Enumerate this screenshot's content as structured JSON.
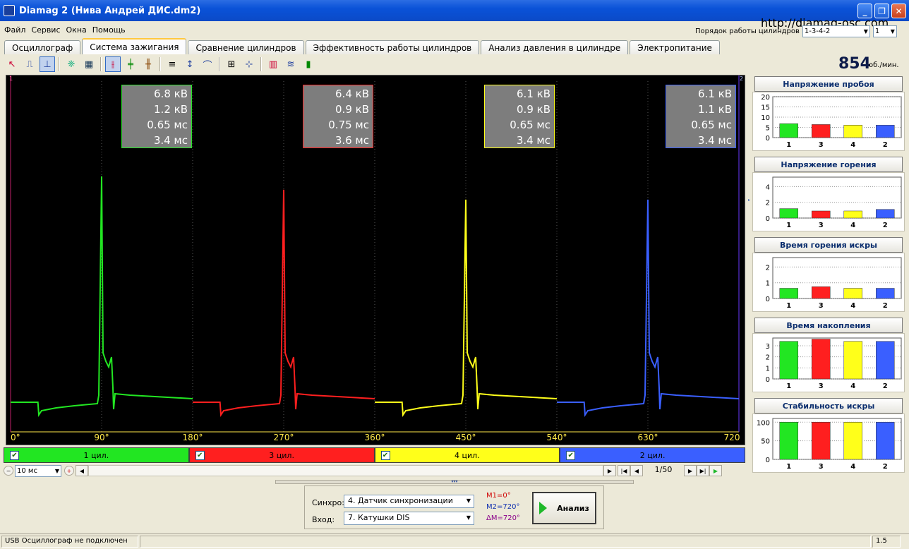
{
  "window": {
    "title": "Diamag 2 (Нива Андрей ДИС.dm2)"
  },
  "menu": {
    "items": [
      "Файл",
      "Сервис",
      "Окна",
      "Помощь"
    ],
    "url": "http://diamag-osc.com"
  },
  "firing_order": {
    "label": "Порядок работы цилиндров",
    "value": "1-3-4-2",
    "second": "1"
  },
  "tabs": [
    {
      "label": "Осциллограф"
    },
    {
      "label": "Система зажигания"
    },
    {
      "label": "Сравнение цилиндров"
    },
    {
      "label": "Эффективность работы цилиндров"
    },
    {
      "label": "Анализ давления в цилиндре"
    },
    {
      "label": "Электропитание"
    }
  ],
  "rpm": {
    "value": "854",
    "unit": "об./мин."
  },
  "scope": {
    "axis_ticks": [
      "0°",
      "90°",
      "180°",
      "270°",
      "360°",
      "450°",
      "540°",
      "630°",
      "720"
    ],
    "markers": [
      "1",
      "2"
    ],
    "cylinders": [
      {
        "color": "#22e622",
        "values": [
          "6.8 кВ",
          "1.2 кВ",
          "0.65 мс",
          "3.4 мс"
        ],
        "peak": 6.8
      },
      {
        "color": "#ff1f1f",
        "values": [
          "6.4 кВ",
          "0.9 кВ",
          "0.75 мс",
          "3.6 мс"
        ],
        "peak": 6.4
      },
      {
        "color": "#ffff1a",
        "values": [
          "6.1 кВ",
          "0.9 кВ",
          "0.65 мс",
          "3.4 мс"
        ],
        "peak": 6.1
      },
      {
        "color": "#3a5fff",
        "values": [
          "6.1 кВ",
          "1.1 кВ",
          "0.65 мс",
          "3.4 мс"
        ],
        "peak": 6.1
      }
    ]
  },
  "legend": [
    {
      "label": "1 цил.",
      "bg": "#22e622"
    },
    {
      "label": "3 цил.",
      "bg": "#ff1f1f"
    },
    {
      "label": "4 цил.",
      "bg": "#ffff1a"
    },
    {
      "label": "2 цил.",
      "bg": "#3a5fff"
    }
  ],
  "nav": {
    "timebase": "10 мс",
    "page": "1/50"
  },
  "controls": {
    "sync_label": "Синхро:",
    "sync_value": "4.  Датчик синхронизации",
    "input_label": "Вход:",
    "input_value": "7.  Катушки DIS",
    "m1": "M1=0°",
    "m2": "M2=720°",
    "dm": "ΔM=720°",
    "analyze_label": "Анализ"
  },
  "side_panels": [
    {
      "title": "Напряжение пробоя",
      "yticks": [
        "20",
        "15",
        "10",
        "5",
        "0"
      ],
      "ymax": 20,
      "values": [
        6.8,
        6.4,
        6.1,
        6.1
      ]
    },
    {
      "title": "Напряжение горения",
      "yticks": [
        "4",
        "2",
        "0"
      ],
      "ymax": 5.2,
      "values": [
        1.2,
        0.9,
        0.9,
        1.1
      ]
    },
    {
      "title": "Время горения искры",
      "yticks": [
        "2",
        "1",
        "0"
      ],
      "ymax": 2.6,
      "values": [
        0.65,
        0.75,
        0.65,
        0.65
      ]
    },
    {
      "title": "Время накопления",
      "yticks": [
        "3",
        "2",
        "1",
        "0"
      ],
      "ymax": 3.7,
      "values": [
        3.4,
        3.6,
        3.4,
        3.4
      ]
    },
    {
      "title": "Стабильность искры",
      "yticks": [
        "100",
        "50",
        "0"
      ],
      "ymax": 110,
      "values": [
        100,
        100,
        100,
        100
      ]
    }
  ],
  "panel_categories": [
    "1",
    "3",
    "4",
    "2"
  ],
  "panel_colors": [
    "#22e622",
    "#ff1f1f",
    "#ffff1a",
    "#3a5fff"
  ],
  "status": {
    "text": "USB Осциллограф не подключен",
    "version": "1.5"
  }
}
